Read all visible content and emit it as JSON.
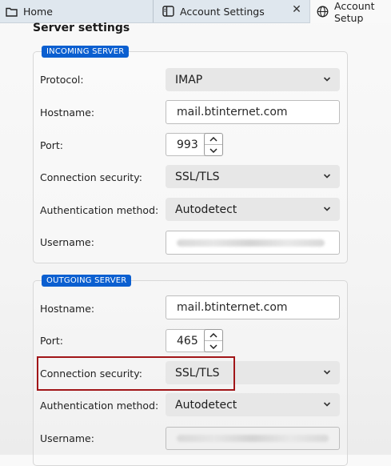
{
  "tabs": [
    {
      "label": "Home",
      "icon": "folder-icon"
    },
    {
      "label": "Account Settings",
      "icon": "account-settings-icon"
    },
    {
      "label": "Account Setup",
      "icon": "globe-icon",
      "active": true
    }
  ],
  "close_glyph": "✕",
  "page_title": "Server settings",
  "incoming": {
    "legend": "INCOMING SERVER",
    "protocol_label": "Protocol:",
    "protocol_value": "IMAP",
    "hostname_label": "Hostname:",
    "hostname_value": "mail.btinternet.com",
    "port_label": "Port:",
    "port_value": "993",
    "security_label": "Connection security:",
    "security_value": "SSL/TLS",
    "auth_label": "Authentication method:",
    "auth_value": "Autodetect",
    "username_label": "Username:"
  },
  "outgoing": {
    "legend": "OUTGOING SERVER",
    "hostname_label": "Hostname:",
    "hostname_value": "mail.btinternet.com",
    "port_label": "Port:",
    "port_value": "465",
    "security_label": "Connection security:",
    "security_value": "SSL/TLS",
    "auth_label": "Authentication method:",
    "auth_value": "Autodetect",
    "username_label": "Username:"
  },
  "colors": {
    "legend_bg": "#0b5fd0",
    "highlight_border": "#a11518",
    "tabbar_bg": "#dfe7ee"
  }
}
